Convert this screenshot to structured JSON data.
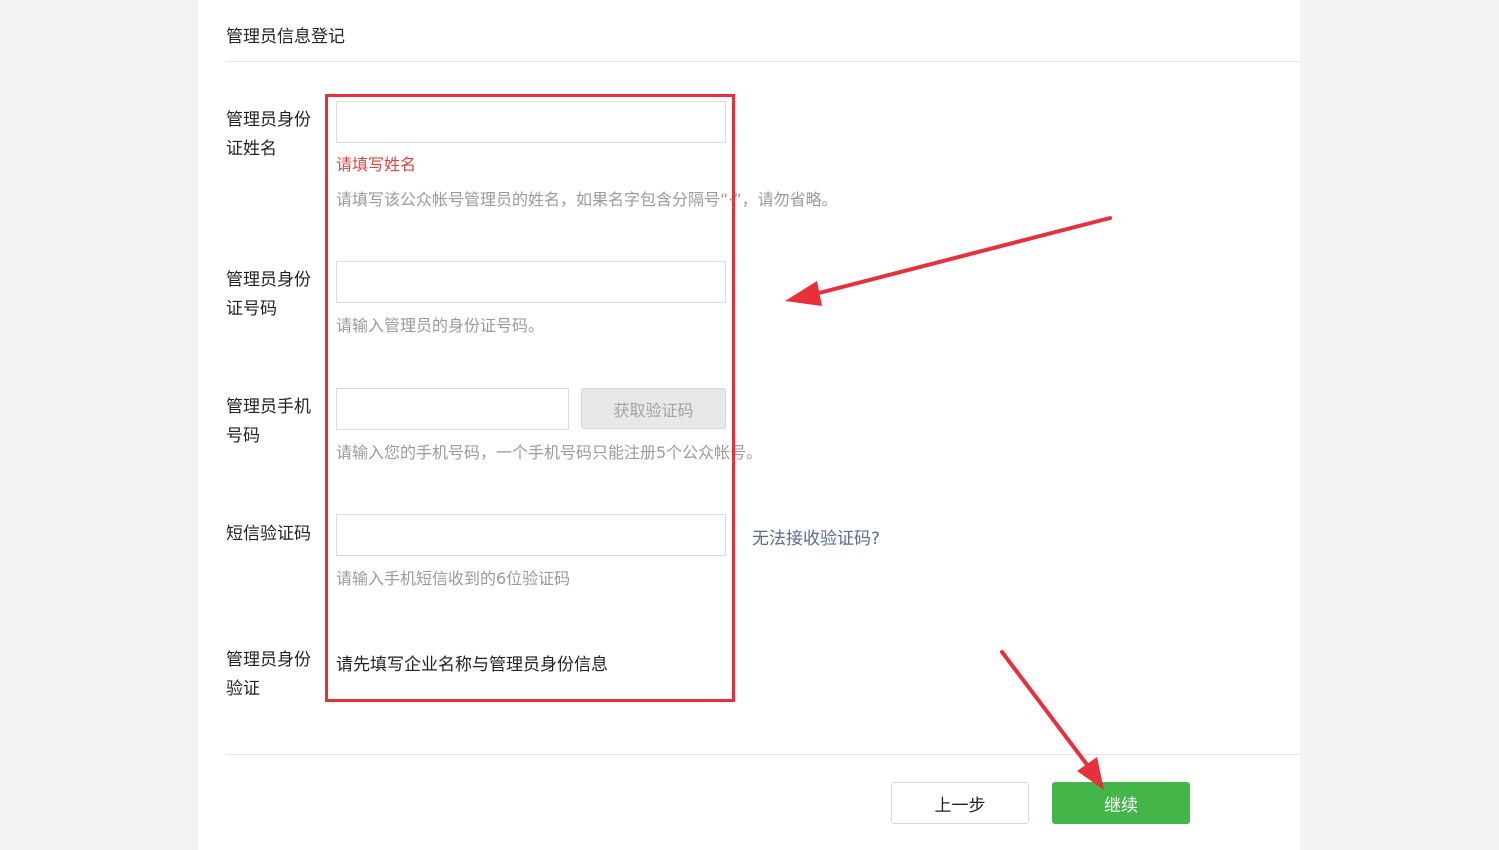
{
  "section_title": "管理员信息登记",
  "fields": {
    "name": {
      "label": "管理员身份证姓名",
      "value": "",
      "error": "请填写姓名",
      "hint": "请填写该公众帐号管理员的姓名，如果名字包含分隔号“·”，请勿省略。"
    },
    "id_number": {
      "label": "管理员身份证号码",
      "value": "",
      "hint": "请输入管理员的身份证号码。"
    },
    "phone": {
      "label": "管理员手机号码",
      "value": "",
      "button": "获取验证码",
      "hint": "请输入您的手机号码，一个手机号码只能注册5个公众帐号。"
    },
    "sms_code": {
      "label": "短信验证码",
      "value": "",
      "link": "无法接收验证码?",
      "hint": "请输入手机短信收到的6位验证码"
    },
    "identity_verify": {
      "label": "管理员身份验证",
      "text": "请先填写企业名称与管理员身份信息"
    }
  },
  "footer": {
    "prev_label": "上一步",
    "next_label": "继续"
  },
  "colors": {
    "accent": "#44b549",
    "error": "#e64340",
    "link": "#576b95",
    "annotation": "#e8303a"
  }
}
